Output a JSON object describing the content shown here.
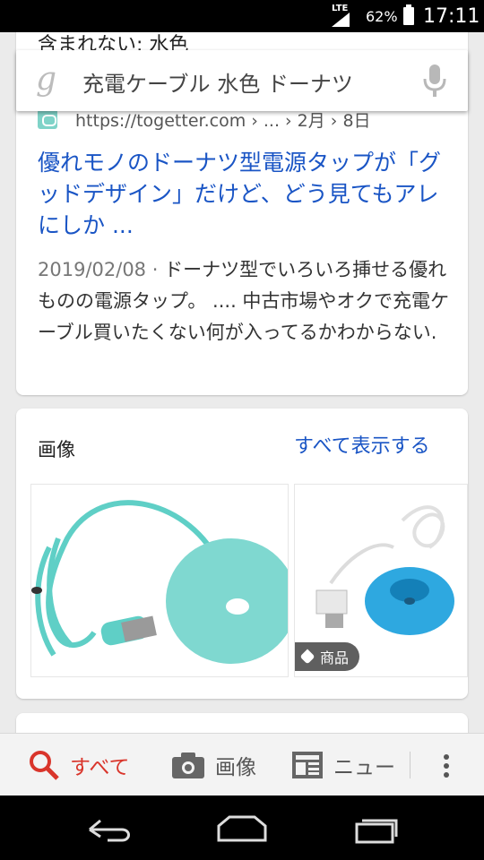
{
  "status_bar": {
    "network": "LTE",
    "battery": "62%",
    "time": "17:11"
  },
  "search": {
    "query": "充電ケーブル 水色 ドーナツ",
    "logo_icon": "google-g-icon",
    "mic_icon": "mic-icon"
  },
  "result": {
    "cut_text": "含まれない: 水色",
    "url": "https://togetter.com › ... › 2月 › 8日",
    "title": "優れモノのドーナツ型電源タップが「グッドデザイン」だけど、どう見てもアレにしか ...",
    "date": "2019/02/08",
    "separator": " · ",
    "snippet": "ドーナツ型でいろいろ挿せる優れものの電源タップ。 .... 中古市場やオクで充電ケーブル買いたくない何が入ってるかわからない."
  },
  "images": {
    "heading": "画像",
    "see_all": "すべて表示する",
    "badge": "商品"
  },
  "tabs": [
    {
      "label": "すべて",
      "icon": "search-icon",
      "active": true
    },
    {
      "label": "画像",
      "icon": "camera-icon",
      "active": false
    },
    {
      "label": "ニュー",
      "icon": "news-icon",
      "active": false
    }
  ],
  "colors": {
    "link": "#1a55c5",
    "active_tab": "#d9352b",
    "donut": "#7fd8d0"
  }
}
